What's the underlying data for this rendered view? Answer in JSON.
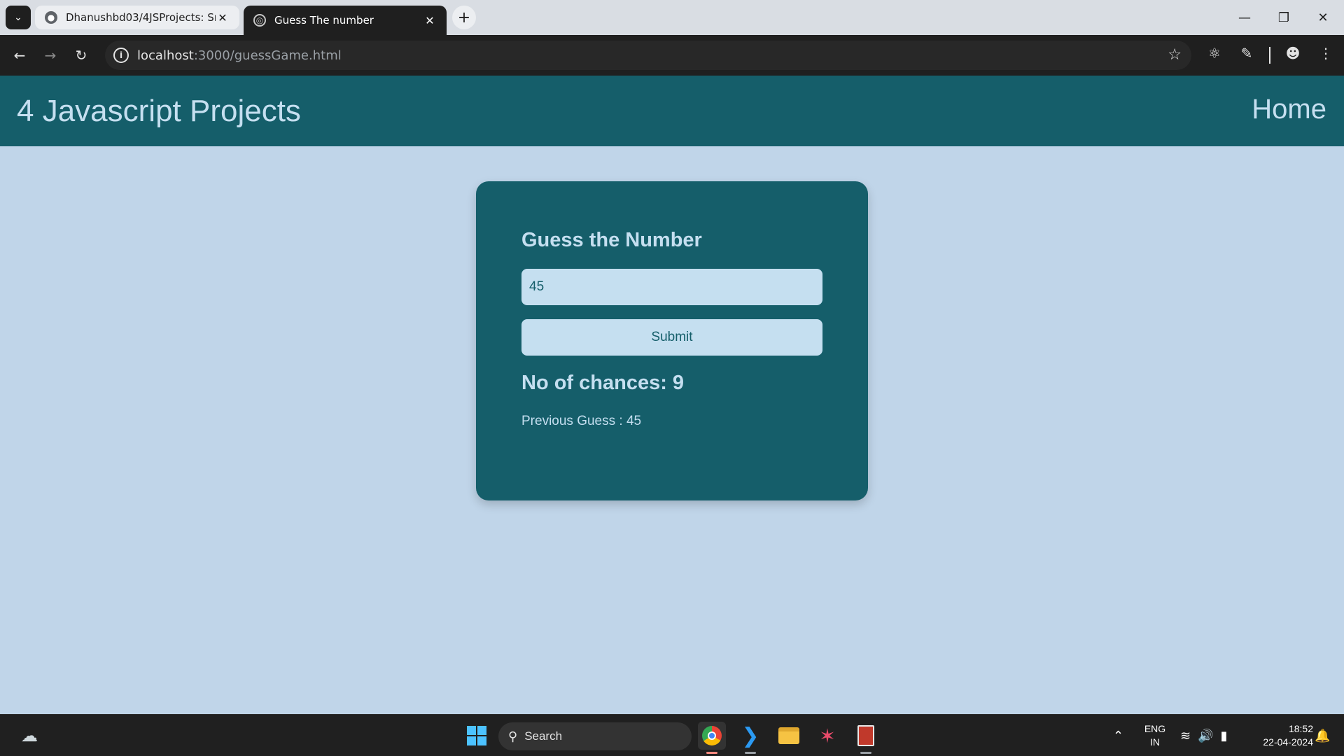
{
  "browser": {
    "tabs": [
      {
        "title": "Dhanushbd03/4JSProjects: Sm",
        "active": false
      },
      {
        "title": "Guess The number",
        "active": true
      }
    ],
    "url_host": "localhost",
    "url_rest": ":3000/guessGame.html"
  },
  "page": {
    "brand": "4 Javascript Projects",
    "nav_home": "Home",
    "card": {
      "title": "Guess the Number",
      "input_value": "45",
      "submit_label": "Submit",
      "chances_text": "No of chances: 9",
      "previous_text": "Previous Guess : 45"
    }
  },
  "taskbar": {
    "search_label": "Search",
    "lang_top": "ENG",
    "lang_bottom": "IN",
    "time": "18:52",
    "date": "22-04-2024"
  },
  "colors": {
    "page_bg": "#c0d5e9",
    "primary": "#155e6a",
    "light": "#c5dff0"
  }
}
